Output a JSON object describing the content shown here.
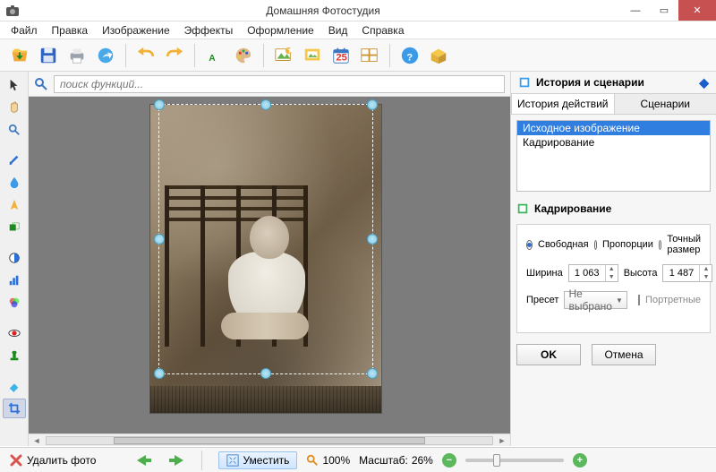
{
  "titlebar": {
    "title": "Домашняя Фотостудия"
  },
  "menu": {
    "file": "Файл",
    "edit": "Правка",
    "image": "Изображение",
    "effects": "Эффекты",
    "decoration": "Оформление",
    "view": "Вид",
    "help": "Справка"
  },
  "search": {
    "placeholder": "поиск функций..."
  },
  "right": {
    "header": "История и сценарии",
    "tab_history": "История действий",
    "tab_scenarios": "Сценарии",
    "hist_item1": "Исходное изображение",
    "hist_item2": "Кадрирование",
    "crop_header": "Кадрирование",
    "mode_free": "Свободная",
    "mode_prop": "Пропорции",
    "mode_exact": "Точный размер",
    "width_label": "Ширина",
    "width_value": "1 063",
    "height_label": "Высота",
    "height_value": "1 487",
    "preset_label": "Пресет",
    "preset_value": "Не выбрано",
    "chk_portrait": "Портретные",
    "ok": "OK",
    "cancel": "Отмена"
  },
  "status": {
    "delete": "Удалить фото",
    "fit": "Уместить",
    "hundred": "100%",
    "scale_label": "Масштаб:",
    "scale_value": "26%"
  },
  "colors": {
    "accent_blue": "#2f7ee0",
    "close_red": "#c75050",
    "green": "#4cae4c",
    "minus_green": "#5cb85c"
  }
}
